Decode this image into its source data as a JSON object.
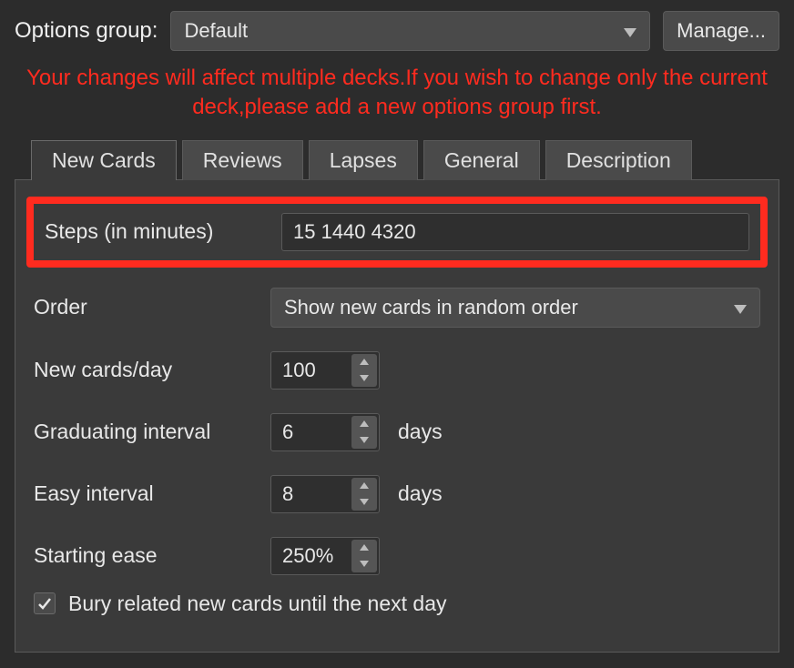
{
  "header": {
    "label": "Options group:",
    "group_value": "Default",
    "manage_label": "Manage..."
  },
  "warning": "Your changes will affect multiple decks.If you wish to change only the current deck,please add a new options group first.",
  "tabs": {
    "new_cards": "New Cards",
    "reviews": "Reviews",
    "lapses": "Lapses",
    "general": "General",
    "description": "Description"
  },
  "form": {
    "steps": {
      "label": "Steps (in minutes)",
      "value": "15 1440 4320"
    },
    "order": {
      "label": "Order",
      "value": "Show new cards in random order"
    },
    "new_per_day": {
      "label": "New cards/day",
      "value": "100"
    },
    "graduating": {
      "label": "Graduating interval",
      "value": "6",
      "suffix": "days"
    },
    "easy": {
      "label": "Easy interval",
      "value": "8",
      "suffix": "days"
    },
    "starting_ease": {
      "label": "Starting ease",
      "value": "250%"
    },
    "bury": {
      "label": "Bury related new cards until the next day",
      "checked": true
    }
  }
}
